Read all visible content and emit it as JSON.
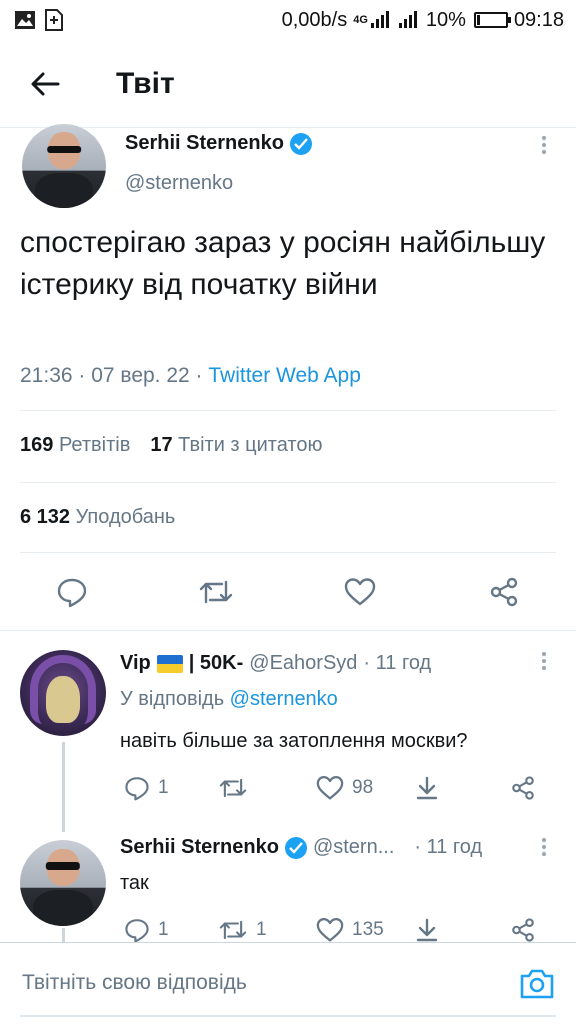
{
  "status_bar": {
    "net_speed": "0,00b/s",
    "network": "4G",
    "battery_pct": "10%",
    "battery_level": 0.1,
    "time": "09:18"
  },
  "header": {
    "title": "Твіт"
  },
  "tweet": {
    "author_name": "Serhii Sternenko",
    "author_handle": "@sternenko",
    "text": "спостерігаю зараз у росіян найбільшу істерику від початку війни",
    "time_date": "21:36 · 07 вер. 22 · ",
    "client": "Twitter Web App",
    "retweets_count": "169",
    "retweets_label": "Ретвітів",
    "quotes_count": "17",
    "quotes_label": "Твіти з цитатою",
    "likes_count": "6 132",
    "likes_label": "Уподобань"
  },
  "replies": [
    {
      "author_name": "Vip",
      "author_suffix": "| 50K-",
      "author_handle": "@EahorSyd",
      "time": "· 11 год",
      "reply_to_prefix": "У відповідь ",
      "reply_to_handle": "@sternenko",
      "text": "навіть більше за затоплення москви?",
      "reply_count": "1",
      "retweet_count": "",
      "like_count": "98"
    },
    {
      "author_name": "Serhii Sternenko",
      "author_handle": "@stern...",
      "time": "· 11 год",
      "text": "так",
      "reply_count": "1",
      "retweet_count": "1",
      "like_count": "135"
    }
  ],
  "composer": {
    "placeholder": "Твітніть свою відповідь"
  },
  "colors": {
    "accent": "#1da1f2",
    "link": "#1b95e0",
    "muted": "#657786",
    "text": "#14171a"
  },
  "icons": [
    "back-arrow-icon",
    "verified-icon",
    "more-icon",
    "reply-icon",
    "retweet-icon",
    "like-icon",
    "share-icon",
    "download-icon",
    "camera-icon",
    "image-icon",
    "sim-icon",
    "signal-icon",
    "battery-icon"
  ]
}
